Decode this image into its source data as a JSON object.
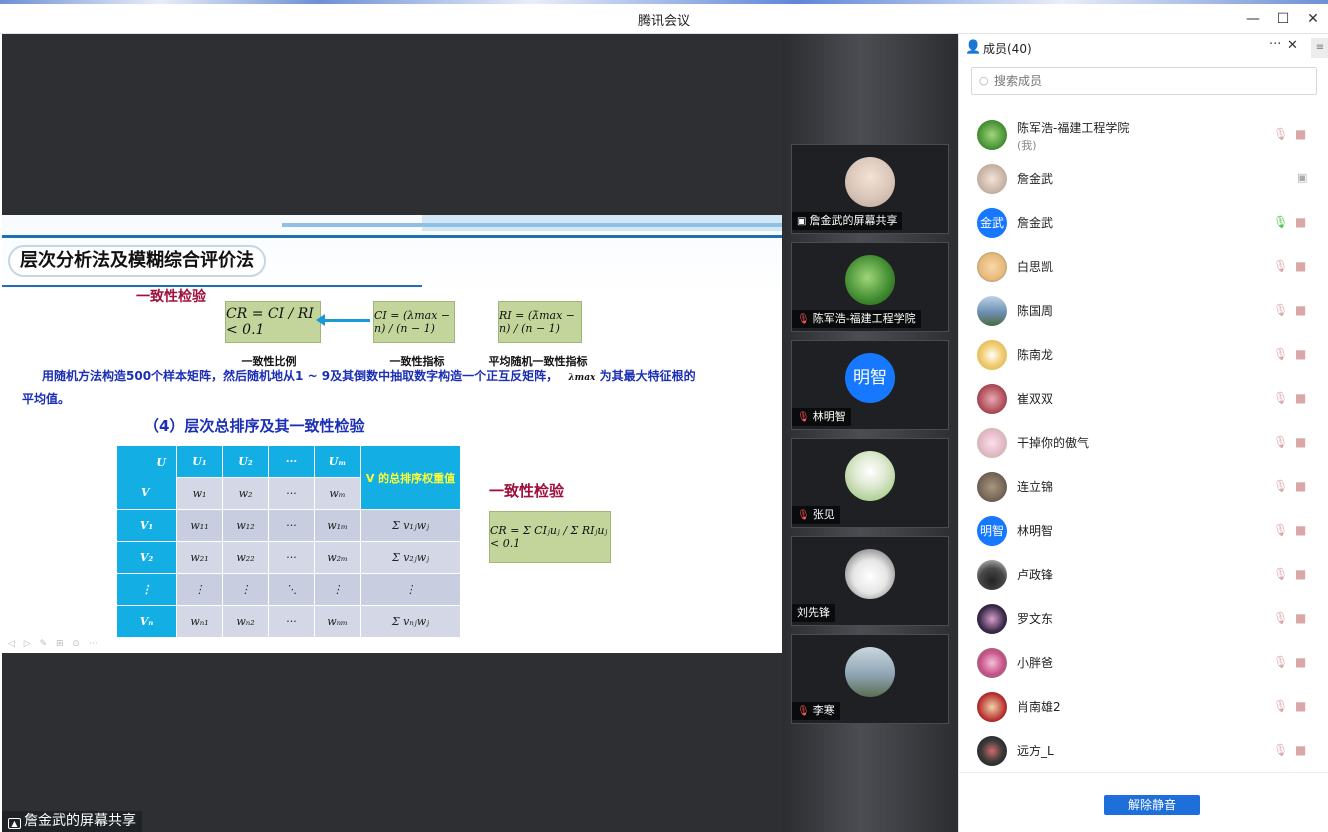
{
  "window": {
    "title": "腾讯会议",
    "min": "—",
    "max": "☐",
    "close": "✕"
  },
  "slide": {
    "title": "层次分析法及模糊综合评价法",
    "consistency_head": "一致性检验",
    "formula_cr": "CR = CI / RI < 0.1",
    "formula_ci": "CI = (λmax − n) / (n − 1)",
    "formula_ri": "RI = (λ̄max − n) / (n − 1)",
    "cap_cr": "一致性比例",
    "cap_ci": "一致性指标",
    "cap_ri": "平均随机一致性指标",
    "para_line1": "用随机方法构造500个样本矩阵，然后随机地从1 ~ 9及其倒数中抽取数字构造一个正互反矩阵，",
    "para_lambda": "λmax",
    "para_tail": "为其最大特征根的",
    "para_line2": "平均值。",
    "sub_head": "（4）层次总排序及其一致性检验",
    "table": {
      "corner_u": "U",
      "corner_v": "V",
      "col_heads": [
        "U₁",
        "U₂",
        "···",
        "Uₘ"
      ],
      "weights": [
        "w₁",
        "w₂",
        "···",
        "wₘ"
      ],
      "last_head": "V 的总排序权重值",
      "rows": [
        [
          "V₁",
          "w₁₁",
          "w₁₂",
          "···",
          "w₁ₘ",
          "Σ v₁ⱼwⱼ"
        ],
        [
          "V₂",
          "w₂₁",
          "w₂₂",
          "···",
          "w₂ₘ",
          "Σ v₂ⱼwⱼ"
        ],
        [
          "⋮",
          "⋮",
          "⋮",
          "⋱",
          "⋮",
          "⋮"
        ],
        [
          "Vₙ",
          "wₙ₁",
          "wₙ₂",
          "···",
          "wₙₘ",
          "Σ vₙⱼwⱼ"
        ]
      ]
    },
    "check_head": "一致性检验",
    "formula_total": "CR = Σ CIⱼuⱼ / Σ RIⱼuⱼ < 0.1"
  },
  "share_label": "詹金武的屏幕共享",
  "video_tiles": [
    {
      "name": "詹金武的屏幕共享",
      "status": "screen",
      "avatar_color": "#d9c6b8"
    },
    {
      "name": "陈军浩-福建工程学院",
      "status": "muted",
      "avatar_color": "#3f8a2e"
    },
    {
      "name": "林明智",
      "status": "muted",
      "avatar_text": "明智",
      "avatar_color": "#1677ff"
    },
    {
      "name": "张见",
      "status": "muted",
      "avatar_color": "#8fbf6a"
    },
    {
      "name": "刘先锋",
      "status": "none",
      "avatar_color": "#e6e6e6"
    },
    {
      "name": "李寒",
      "status": "muted",
      "avatar_color": "#8fa5b5"
    }
  ],
  "panel": {
    "title": "成员(40)",
    "more": "···",
    "close": "✕",
    "menu": "≡",
    "search_placeholder": "搜索成员",
    "members": [
      {
        "name": "陈军浩-福建工程学院",
        "sub": "(我)",
        "avatar_color": "#3f8a2e",
        "mic": "off",
        "right": "cam"
      },
      {
        "name": "詹金武",
        "avatar_color": "#d9c6b8",
        "mic": "none",
        "right": "screen"
      },
      {
        "name": "詹金武",
        "avatar_text": "金武",
        "avatar_color": "#1677ff",
        "mic": "on",
        "right": "cam"
      },
      {
        "name": "白思凯",
        "avatar_color": "#e8b87a",
        "mic": "off",
        "right": "cam"
      },
      {
        "name": "陈国周",
        "avatar_color": "#6b8fb0",
        "mic": "off",
        "right": "cam"
      },
      {
        "name": "陈南龙",
        "avatar_color": "#d9a441",
        "mic": "off",
        "right": "cam"
      },
      {
        "name": "崔双双",
        "avatar_color": "#b04f5a",
        "mic": "off",
        "right": "cam"
      },
      {
        "name": "干掉你的傲气",
        "avatar_color": "#e5b8c8",
        "mic": "off",
        "right": "cam"
      },
      {
        "name": "连立锦",
        "avatar_color": "#7a6a5a",
        "mic": "off",
        "right": "cam"
      },
      {
        "name": "林明智",
        "avatar_text": "明智",
        "avatar_color": "#1677ff",
        "mic": "off",
        "right": "cam"
      },
      {
        "name": "卢政锋",
        "avatar_color": "#4a4a4a",
        "mic": "off",
        "right": "cam"
      },
      {
        "name": "罗文东",
        "avatar_color": "#3a2a4a",
        "mic": "off",
        "right": "cam"
      },
      {
        "name": "小胖爸",
        "avatar_color": "#c8508a",
        "mic": "off",
        "right": "cam"
      },
      {
        "name": "肖南雄2",
        "avatar_color": "#b52a2a",
        "mic": "off",
        "right": "cam"
      },
      {
        "name": "远方_L",
        "avatar_color": "#3a3a3a",
        "mic": "off",
        "right": "cam"
      }
    ],
    "unmute_label": "解除静音"
  }
}
